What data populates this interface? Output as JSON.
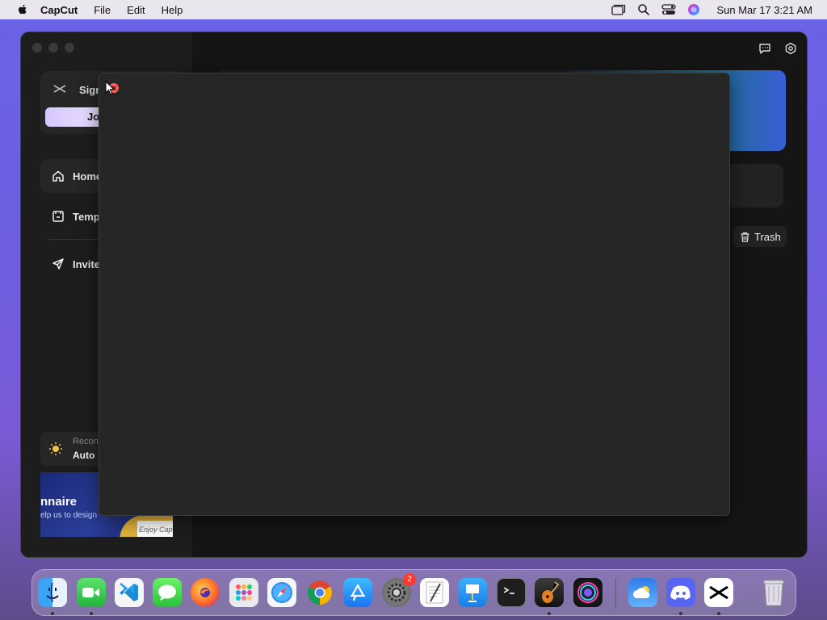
{
  "menubar": {
    "app_name": "CapCut",
    "menus": [
      "File",
      "Edit",
      "Help"
    ],
    "clock": "Sun Mar 17  3:21 AM"
  },
  "sidebar": {
    "signin_label": "Sign",
    "join_label": "Jo",
    "nav": [
      {
        "label": "Home",
        "icon": "home-icon"
      },
      {
        "label": "Temp",
        "icon": "template-icon"
      },
      {
        "label": "Invite",
        "icon": "send-icon"
      }
    ],
    "reco": {
      "line1": "Recon",
      "line2": "Auto"
    },
    "banner": {
      "title": "nnaire",
      "subtitle": "elp us to design",
      "enjoy": "Enjoy Cap"
    }
  },
  "main": {
    "trash_label": "Trash"
  },
  "dock": {
    "apps": [
      "finder",
      "facetime",
      "vscode",
      "messages",
      "firefox",
      "launchpad",
      "safari",
      "chrome",
      "app-store",
      "system-settings",
      "textedit",
      "keynote",
      "terminal",
      "garageband",
      "siri",
      "weather",
      "discord",
      "capcut",
      "trash"
    ],
    "settings_badge": "2"
  },
  "colors": {
    "desktop_top": "#6a63e6",
    "window_bg": "#151515",
    "modal_bg": "#262626",
    "close_red": "#ff5f57"
  }
}
